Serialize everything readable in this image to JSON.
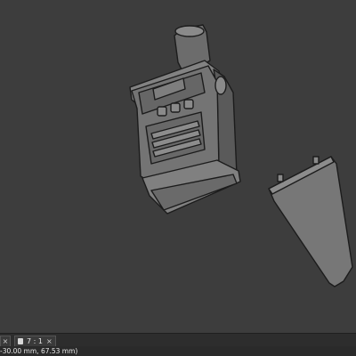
{
  "tabbar": {
    "left_close": "×",
    "zoom_label": "7 : 1",
    "zoom_close": "×"
  },
  "statusbar": {
    "coordinates": "-30.00 mm, 67.53 mm)"
  },
  "icons": {
    "document": "document-icon",
    "close": "close-icon"
  },
  "colors": {
    "viewport_bg": "#3d3d3d",
    "model_face": "#777777",
    "model_edge": "#1c1c1c",
    "status_bg": "#2a2a2a"
  }
}
